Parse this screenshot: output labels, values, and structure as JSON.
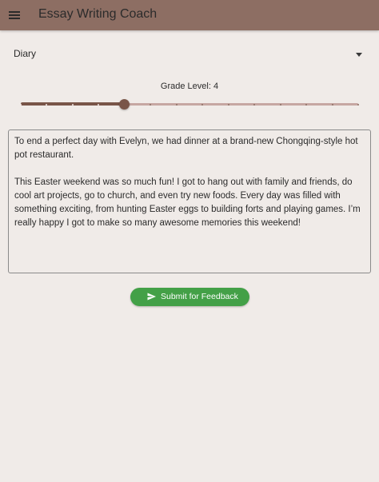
{
  "app": {
    "title": "Essay Writing Coach",
    "menu_icon": "menu-icon"
  },
  "essay_type": {
    "selected": "Diary",
    "icon": "dropdown-arrow-icon"
  },
  "grade": {
    "label": "Grade Level: 4",
    "value": 4,
    "min": 0,
    "max": 13
  },
  "essay": {
    "text": "To end a perfect day with Evelyn, we had dinner at a brand-new Chongqing-style hot pot restaurant.\n\nThis Easter weekend was so much fun! I got to hang out with family and friends, do cool art projects, go to church, and even try new foods. Every day was filled with something exciting, from hunting Easter eggs to building forts and playing games. I’m really happy I got to make so many awesome memories this weekend!"
  },
  "submit": {
    "label": "Submit for Feedback",
    "icon": "send-icon"
  },
  "colors": {
    "appbar": "#8d6e63",
    "background": "#f0ebe8",
    "slider_active": "#795548",
    "slider_inactive": "#c6a7a2",
    "submit_button": "#43a047"
  }
}
